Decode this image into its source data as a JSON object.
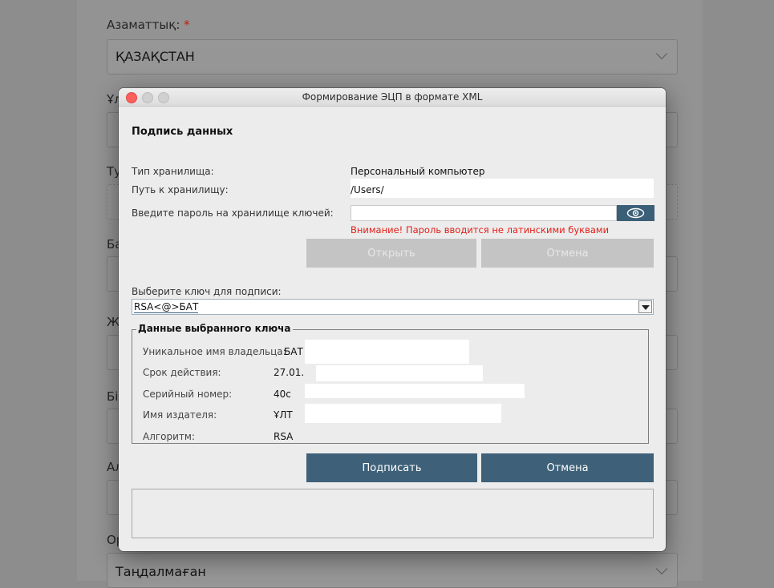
{
  "background_form": {
    "citizenship_label": "Азаматтық:",
    "required_mark": "*",
    "citizenship_value": "ҚАЗАҚСТАН",
    "stub_1": "Ұл",
    "stub_2": "Ту",
    "stub_3": "Ба",
    "stub_4": "Ж",
    "stub_5": "Бі",
    "stub_6": "Ал",
    "stub_7": "Ор",
    "bottom_select_value": "Таңдалмаған"
  },
  "dialog": {
    "title": "Формирование ЭЦП в формате XML",
    "section_title": "Подпись данных",
    "storage_type_label": "Тип хранилища:",
    "storage_type_value": "Персональный компьютер",
    "storage_path_label": "Путь к хранилищу:",
    "storage_path_value": "/Users/",
    "password_label": "Введите пароль на хранилище ключей:",
    "password_warning": "Внимание! Пароль вводится не латинскими буквами",
    "open_button": "Открыть",
    "cancel_button_top": "Отмена",
    "choose_key_label": "Выберите ключ для подписи:",
    "selected_key": "RSA<@>БАТ",
    "key_details": {
      "legend": "Данные выбранного ключа",
      "owner_label": "Уникальное имя владельца:",
      "owner_value": "БАТ",
      "validity_label": "Срок действия:",
      "validity_value": "27.01.",
      "serial_label": "Серийный номер:",
      "serial_value": "40c",
      "issuer_label": "Имя издателя:",
      "issuer_value": "ҰЛТ",
      "algorithm_label": "Алгоритм:",
      "algorithm_value": "RSA"
    },
    "sign_button": "Подписать",
    "cancel_button": "Отмена"
  },
  "colors": {
    "primary_button": "#3e6179",
    "warning": "#e0201a",
    "close_light": "#fc605c"
  }
}
